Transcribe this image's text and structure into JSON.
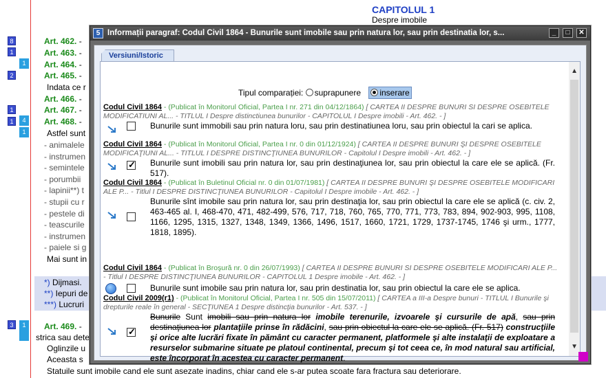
{
  "background": {
    "chapter_title": "CAPITOLUL 1",
    "chapter_sub": "Despre imobile",
    "badges": [
      "8",
      "1",
      "1",
      "2",
      "1",
      "1",
      "4",
      "1",
      "3",
      "1"
    ],
    "articles": [
      {
        "label": "Art. 462.",
        "tail": " -"
      },
      {
        "label": "Art. 463.",
        "tail": " -"
      },
      {
        "label": "Art. 464.",
        "tail": " -"
      },
      {
        "label": "Art. 465.",
        "tail": " -"
      },
      {
        "label": "Art. 466.",
        "tail": " -"
      },
      {
        "label": "Art. 467.",
        "tail": " -"
      },
      {
        "label": "Art. 468.",
        "tail": " -"
      },
      {
        "label": "Art. 469.",
        "tail": " -"
      }
    ],
    "lines": [
      "Indata ce r",
      "Astfel sunt",
      "- animalele",
      "- instrumen",
      "- semintele",
      "- porumbii",
      "- lapinii**) t",
      "- stupii cu r",
      "- pestele di",
      "- teascurile",
      "- instrumen",
      "- paiele si g",
      "Mai sunt in"
    ],
    "notes": [
      {
        "mark": "*)",
        "text": " Dijmasi."
      },
      {
        "mark": "**)",
        "text": " Iepuri de"
      },
      {
        "mark": "***)",
        "text": " Lucruri"
      }
    ],
    "tail_lines": [
      "strica sau dete",
      "Oglinzile u",
      "Aceasta s",
      "Statuile sunt imobile cand ele sunt asezate inadins, chiar cand ele s-ar putea scoate fara fractura sau deteriorare."
    ]
  },
  "dialog": {
    "icon_label": "5",
    "title": "Informații paragraf: Codul Civil 1864 -  Bunurile sunt imobile sau prin natura lor, sau prin destinatia lor, s...",
    "btn_min": "_",
    "btn_max": "□",
    "btn_close": "✕",
    "tab_label": "Versiuni/Istoric",
    "compare_label": "Tipul comparației:",
    "opt_overlay": "suprapunere",
    "opt_insert": "inserare",
    "selected_option": "inserare",
    "versions": [
      {
        "code": "Codul Civil 1864",
        "pub": " - (Publicat în Monitorul Oficial, Partea I nr. 271 din 04/12/1864)",
        "path": "   [ CARTEA II DESPRE BUNURI SI DESPRE OSEBITELE MODIFICATIUNI AL... - TITLUL I Despre distinctiunea bunurilor - CAPITOLUL I Despre imobili - Art. 462. - ]",
        "text": "Bunurile sunt immobili sau prin natura loru, sau prin destinatiunea loru, sau prin obiectul la cari se aplica.",
        "checked": false,
        "icon": "arrow-icon"
      },
      {
        "code": "Codul Civil 1864",
        "pub": " - (Publicat în Monitorul Oficial, Partea I nr. 0 din 01/12/1924)",
        "path": "   [ CARTEA II DESPRE BUNURI ŞI DESPRE OSEBITELE MODIFICAŢIUNI AL... - TITLUL I DESPRE DISTINCŢIUNEA BUNURILOR - Capitolul I Despre imobili - Art. 462. - ]",
        "text": "Bunurile sunt imobili sau prin natura lor, sau prin destinaţiunea lor, sau prin obiectul la care ele se aplică. (Fr. 517).",
        "checked": true,
        "icon": "arrow-icon"
      },
      {
        "code": "Codul Civil 1864",
        "pub": " - (Publicat în Buletinul Oficial nr. 0 din 01/07/1981)",
        "path": "   [ CARTEA II DESPRE BUNURI ŞI DESPRE OSEBITELE MODIFICARI ALE P... - Titlul I DESPRE DISTINCŢIUNEA BUNURILOR - Capitolul I Despre imobile - Art. 462. - ]",
        "text": "Bunurile sînt imobile sau prin natura lor, sau prin destinaţia lor, sau prin obiectul la care ele se aplică (c. civ. 2, 463-465 al. I, 468-470, 471, 482-499, 576, 717, 718, 760, 765, 770, 771, 773, 783, 894, 902-903, 995, 1108, 1166, 1295, 1315, 1327, 1348, 1349, 1366, 1496, 1517, 1660, 1721, 1729, 1737-1745, 1746 şi urm., 1777, 1818, 1895).",
        "checked": false,
        "icon": "arrow-icon"
      },
      {
        "code": "Codul Civil 1864",
        "pub": " - (Publicat în Broşură nr. 0 din 26/07/1993)",
        "path": "   [ CARTEA II DESPRE BUNURI SI DESPRE OSEBITELE MODIFICARI ALE P... - Titlul I DESPRE DISTINCŢIUNEA BUNURILOR - CAPITOLUL 1 Despre imobile - Art. 462. - ]",
        "text": "Bunurile sunt imobile sau prin natura lor, sau prin destinatia lor, sau prin obiectul la care ele se aplica.",
        "checked": false,
        "icon": "globe-icon"
      }
    ],
    "last_version": {
      "code": "Codul Civil 2009(r1)",
      "pub": " - (Publicat în Monitorul Oficial, Partea I nr. 505 din 15/07/2011)",
      "path": "   [ CARTEA a III-a Despre bunuri - TITLUL I Bunurile şi drepturile reale în general - SECŢIUNEA 1 Despre distincţia bunurilor - Art. 537. - ]",
      "seg1_strike": "Bunurile",
      "seg2": " Sunt ",
      "seg3_strike": "imobili sau prin natura lor",
      "seg4_bold": " imobile terenurile, izvoarele şi cursurile de apă",
      "seg5": ", ",
      "seg6_strike": "sau prin destinaţiunea lor",
      "seg7_bold": " plantaţiile prinse în rădăcini",
      "seg8": ", ",
      "seg9_strike": "sau prin obiectul la care ele se aplică. (Fr. 517)",
      "seg10_bold": " construcţiile şi orice alte lucrări fixate în pământ cu caracter permanent, platformele şi alte instalaţii de exploatare a resurselor submarine situate pe platoul continental, precum şi tot ceea ce, în mod natural sau artificial, este încorporat în acestea cu caracter permanent",
      "seg11": ".",
      "checked": true
    }
  }
}
